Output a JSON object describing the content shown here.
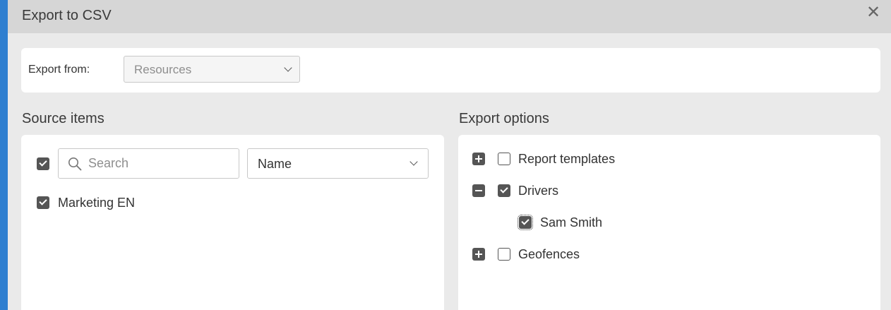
{
  "dialog": {
    "title": "Export to CSV",
    "close_glyph": "✕"
  },
  "export_from": {
    "label": "Export from:",
    "selected": "Resources"
  },
  "source": {
    "title": "Source items",
    "search_placeholder": "Search",
    "search_value": "",
    "sort_selected": "Name",
    "select_all_checked": true,
    "items": [
      {
        "label": "Marketing EN",
        "checked": true
      }
    ]
  },
  "options": {
    "title": "Export options",
    "groups": [
      {
        "label": "Report templates",
        "expanded": false,
        "checked": false,
        "children": []
      },
      {
        "label": "Drivers",
        "expanded": true,
        "checked": true,
        "children": [
          {
            "label": "Sam Smith",
            "checked": true
          }
        ]
      },
      {
        "label": "Geofences",
        "expanded": false,
        "checked": false,
        "children": []
      }
    ]
  },
  "colors": {
    "window_frame": "#2f7fd0",
    "dialog_bg": "#eaeaea",
    "titlebar_bg": "#d6d6d6",
    "panel_bg": "#ffffff",
    "checkbox_fill": "#555555",
    "border": "#c8c8c8"
  }
}
